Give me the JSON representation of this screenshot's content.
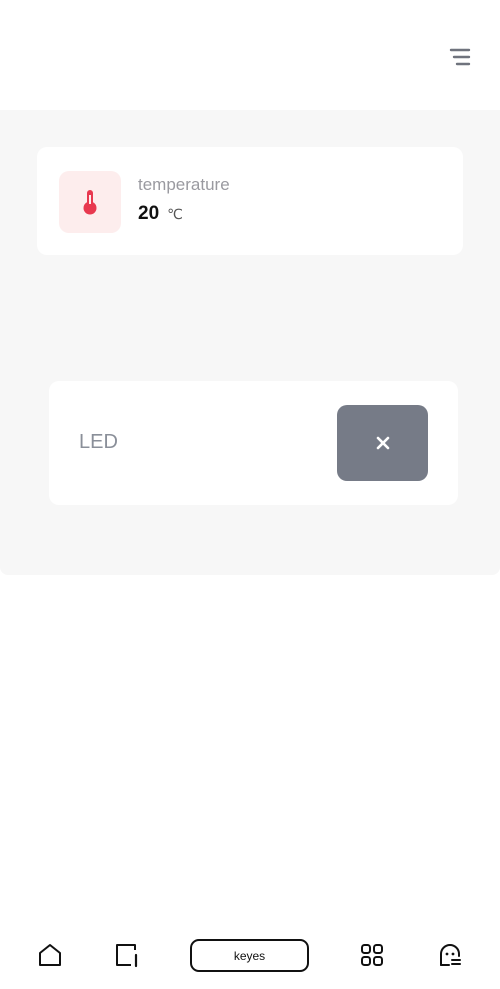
{
  "header": {
    "menu_icon": "menu-icon"
  },
  "temperature_card": {
    "icon": "thermometer-icon",
    "label": "temperature",
    "value": "20",
    "unit": "℃",
    "accent_color": "#e8384f",
    "icon_bg_color": "#fdeded"
  },
  "led_card": {
    "label": "LED",
    "toggle_icon": "close-icon",
    "toggle_color": "#767b87"
  },
  "bottom_nav": {
    "items": [
      {
        "name": "home",
        "icon": "home-icon"
      },
      {
        "name": "devices",
        "icon": "device-icon"
      },
      {
        "name": "center",
        "label": "keyes"
      },
      {
        "name": "apps",
        "icon": "grid-icon"
      },
      {
        "name": "profile",
        "icon": "profile-icon"
      }
    ]
  }
}
